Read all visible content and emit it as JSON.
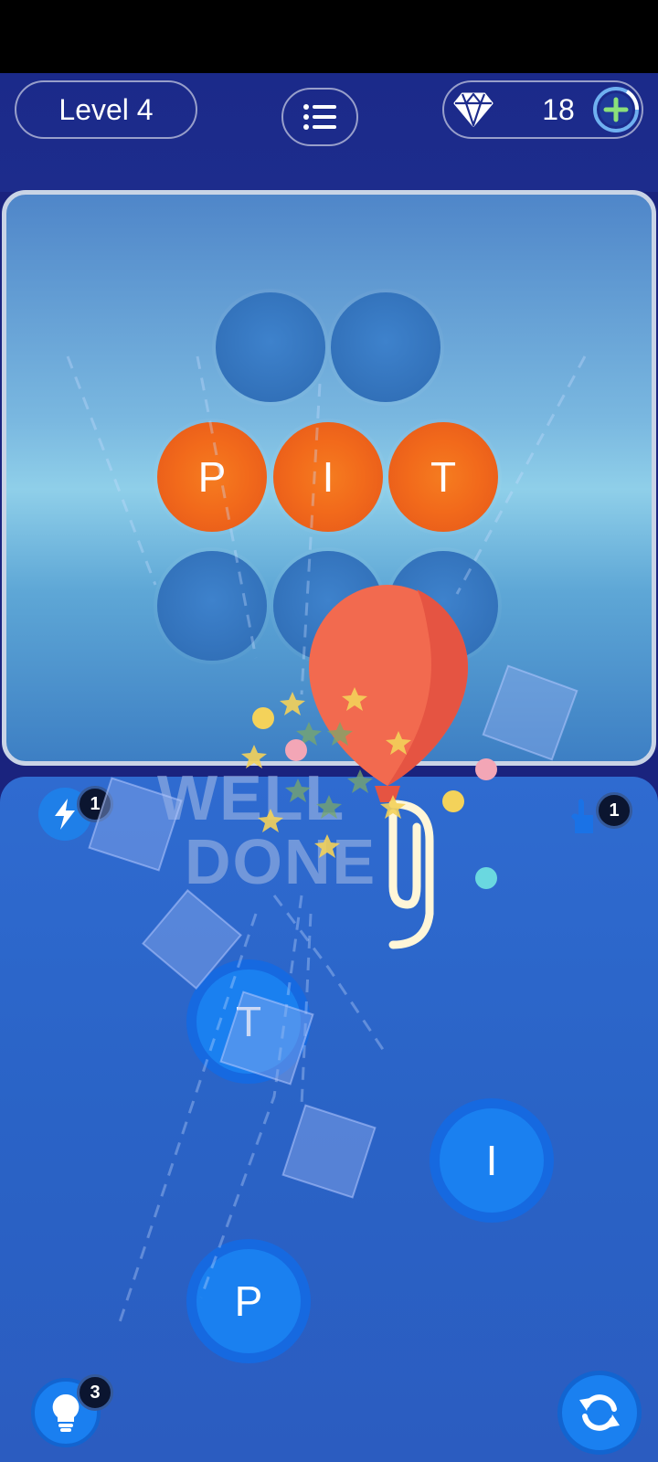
{
  "header": {
    "level_label": "Level 4",
    "gems": "18"
  },
  "board": {
    "row1": [
      "",
      ""
    ],
    "row2": [
      "P",
      "I",
      "T"
    ],
    "row3": [
      "",
      "",
      ""
    ]
  },
  "celebration": {
    "line1": "WELL",
    "line2": "DONE"
  },
  "powerups": {
    "bolt_count": "1",
    "finger_count": "1",
    "hint_count": "3"
  },
  "letters": [
    "T",
    "I",
    "P"
  ],
  "colors": {
    "accent_orange": "#f26a1b",
    "letter_blue": "#1a80f0",
    "header_navy": "#1b2a8a"
  }
}
